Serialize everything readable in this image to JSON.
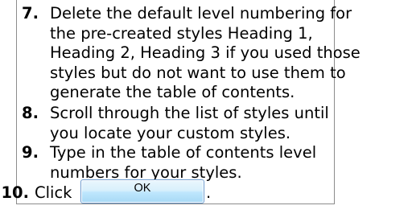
{
  "steps": [
    {
      "number": "7.",
      "lines": [
        "Delete the default level numbering for",
        "the pre-created styles Heading 1,",
        "Heading 2, Heading 3 if you used those",
        "styles but do not want to use them to",
        "generate the table of contents."
      ]
    },
    {
      "number": "8.",
      "lines": [
        "Scroll through the list of styles until",
        "you locate your custom styles."
      ]
    },
    {
      "number": "9.",
      "lines": [
        "Type in the table of contents level",
        "numbers for your styles."
      ]
    },
    {
      "number": "10.",
      "lines": [
        "Click"
      ],
      "button_label": "OK",
      "trailing_text": "."
    }
  ]
}
